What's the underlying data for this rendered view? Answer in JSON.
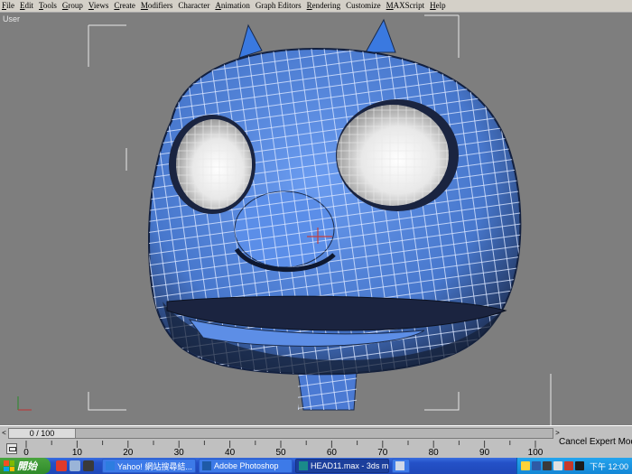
{
  "menu": {
    "items": [
      {
        "label": "File",
        "key": "F",
        "rest": "ile"
      },
      {
        "label": "Edit",
        "key": "E",
        "rest": "dit"
      },
      {
        "label": "Tools",
        "key": "T",
        "rest": "ools"
      },
      {
        "label": "Group",
        "key": "G",
        "rest": "roup"
      },
      {
        "label": "Views",
        "key": "V",
        "rest": "iews"
      },
      {
        "label": "Create",
        "key": "C",
        "rest": "reate"
      },
      {
        "label": "Modifiers",
        "key": "M",
        "rest": "odifiers"
      },
      {
        "label": "Character",
        "key": "",
        "rest": "Character"
      },
      {
        "label": "Animation",
        "key": "A",
        "rest": "nimation"
      },
      {
        "label": "Graph Editors",
        "key": "",
        "rest": "Graph Editors"
      },
      {
        "label": "Rendering",
        "key": "R",
        "rest": "endering"
      },
      {
        "label": "Customize",
        "key": "",
        "rest": "Customize"
      },
      {
        "label": "MAXScript",
        "key": "M",
        "rest": "AXScript"
      },
      {
        "label": "Help",
        "key": "H",
        "rest": "elp"
      }
    ]
  },
  "viewport": {
    "label": "User",
    "background": "#7e7e7e",
    "mesh_color": "#4f7fd6"
  },
  "timeline": {
    "frame_display": "0 / 100",
    "prev": "<",
    "next": ">",
    "ticks": [
      "0",
      "10",
      "20",
      "30",
      "40",
      "50",
      "60",
      "70",
      "80",
      "90",
      "100"
    ],
    "status": "Cancel Expert Mode"
  },
  "taskbar": {
    "start_label": "開始",
    "tasks": [
      {
        "label": "Yahoo! 網站搜尋結...",
        "icon": "ie-icon",
        "active": false
      },
      {
        "label": "Adobe Photoshop",
        "icon": "photoshop-icon",
        "active": false
      },
      {
        "label": "HEAD11.max - 3ds m...",
        "icon": "3dsmax-icon",
        "active": true
      },
      {
        "label": "",
        "icon": "window-icon",
        "active": false
      }
    ],
    "clock": "下午 12:00"
  }
}
